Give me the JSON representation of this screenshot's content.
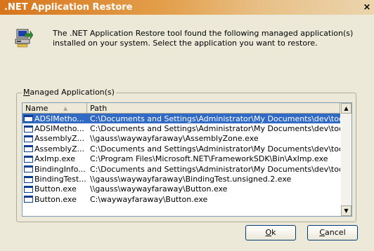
{
  "window": {
    "title": ".NET Application Restore",
    "close_glyph": "×"
  },
  "dialog": {
    "icon": "computer-restore-icon",
    "intro_line1": "The .NET Application Restore tool found the following managed application(s)",
    "intro_line2": "installed on your system. Select the application you want to restore."
  },
  "group": {
    "label_access": "M",
    "label_rest": "anaged Application(s)"
  },
  "list": {
    "columns": [
      "Name",
      "Path"
    ],
    "sort_glyph": "▲",
    "rows": [
      {
        "name": "ADSIMetho...",
        "path": "C:\\Documents and Settings\\Administrator\\My Documents\\dev\\tools\\...",
        "icon": "exe-window-icon",
        "selected": true
      },
      {
        "name": "ADSIMetho...",
        "path": "C:\\Documents and Settings\\Administrator\\My Documents\\dev\\tools\\...",
        "icon": "exe-window-icon",
        "selected": false
      },
      {
        "name": "AssemblyZ...",
        "path": "\\\\gauss\\waywayfaraway\\AssemblyZone.exe",
        "icon": "exe-window-icon",
        "selected": false
      },
      {
        "name": "AssemblyZ...",
        "path": "C:\\Documents and Settings\\Administrator\\My Documents\\dev\\tools\\...",
        "icon": "exe-window-icon",
        "selected": false
      },
      {
        "name": "AxImp.exe",
        "path": "C:\\Program Files\\Microsoft.NET\\FrameworkSDK\\Bin\\AxImp.exe",
        "icon": "exe-window-icon",
        "selected": false
      },
      {
        "name": "BindingInfo...",
        "path": "C:\\Documents and Settings\\Administrator\\My Documents\\dev\\tools\\...",
        "icon": "exe-window-icon",
        "selected": false
      },
      {
        "name": "BindingTest...",
        "path": "\\\\gauss\\waywayfaraway\\BindingTest.unsigned.2.exe",
        "icon": "exe-window-icon",
        "selected": false
      },
      {
        "name": "Button.exe",
        "path": "\\\\gauss\\waywayfaraway\\Button.exe",
        "icon": "exe-window-icon",
        "selected": false
      },
      {
        "name": "Button.exe",
        "path": "C:\\waywayfaraway\\Button.exe",
        "icon": "exe-window-icon",
        "selected": false
      }
    ]
  },
  "buttons": {
    "ok_access": "O",
    "ok_rest": "k",
    "cancel_access": "C",
    "cancel_rest": "ancel"
  },
  "colors": {
    "title_start": "#d7751c",
    "selection": "#316ac5",
    "dialog_bg": "#ece9d8"
  }
}
